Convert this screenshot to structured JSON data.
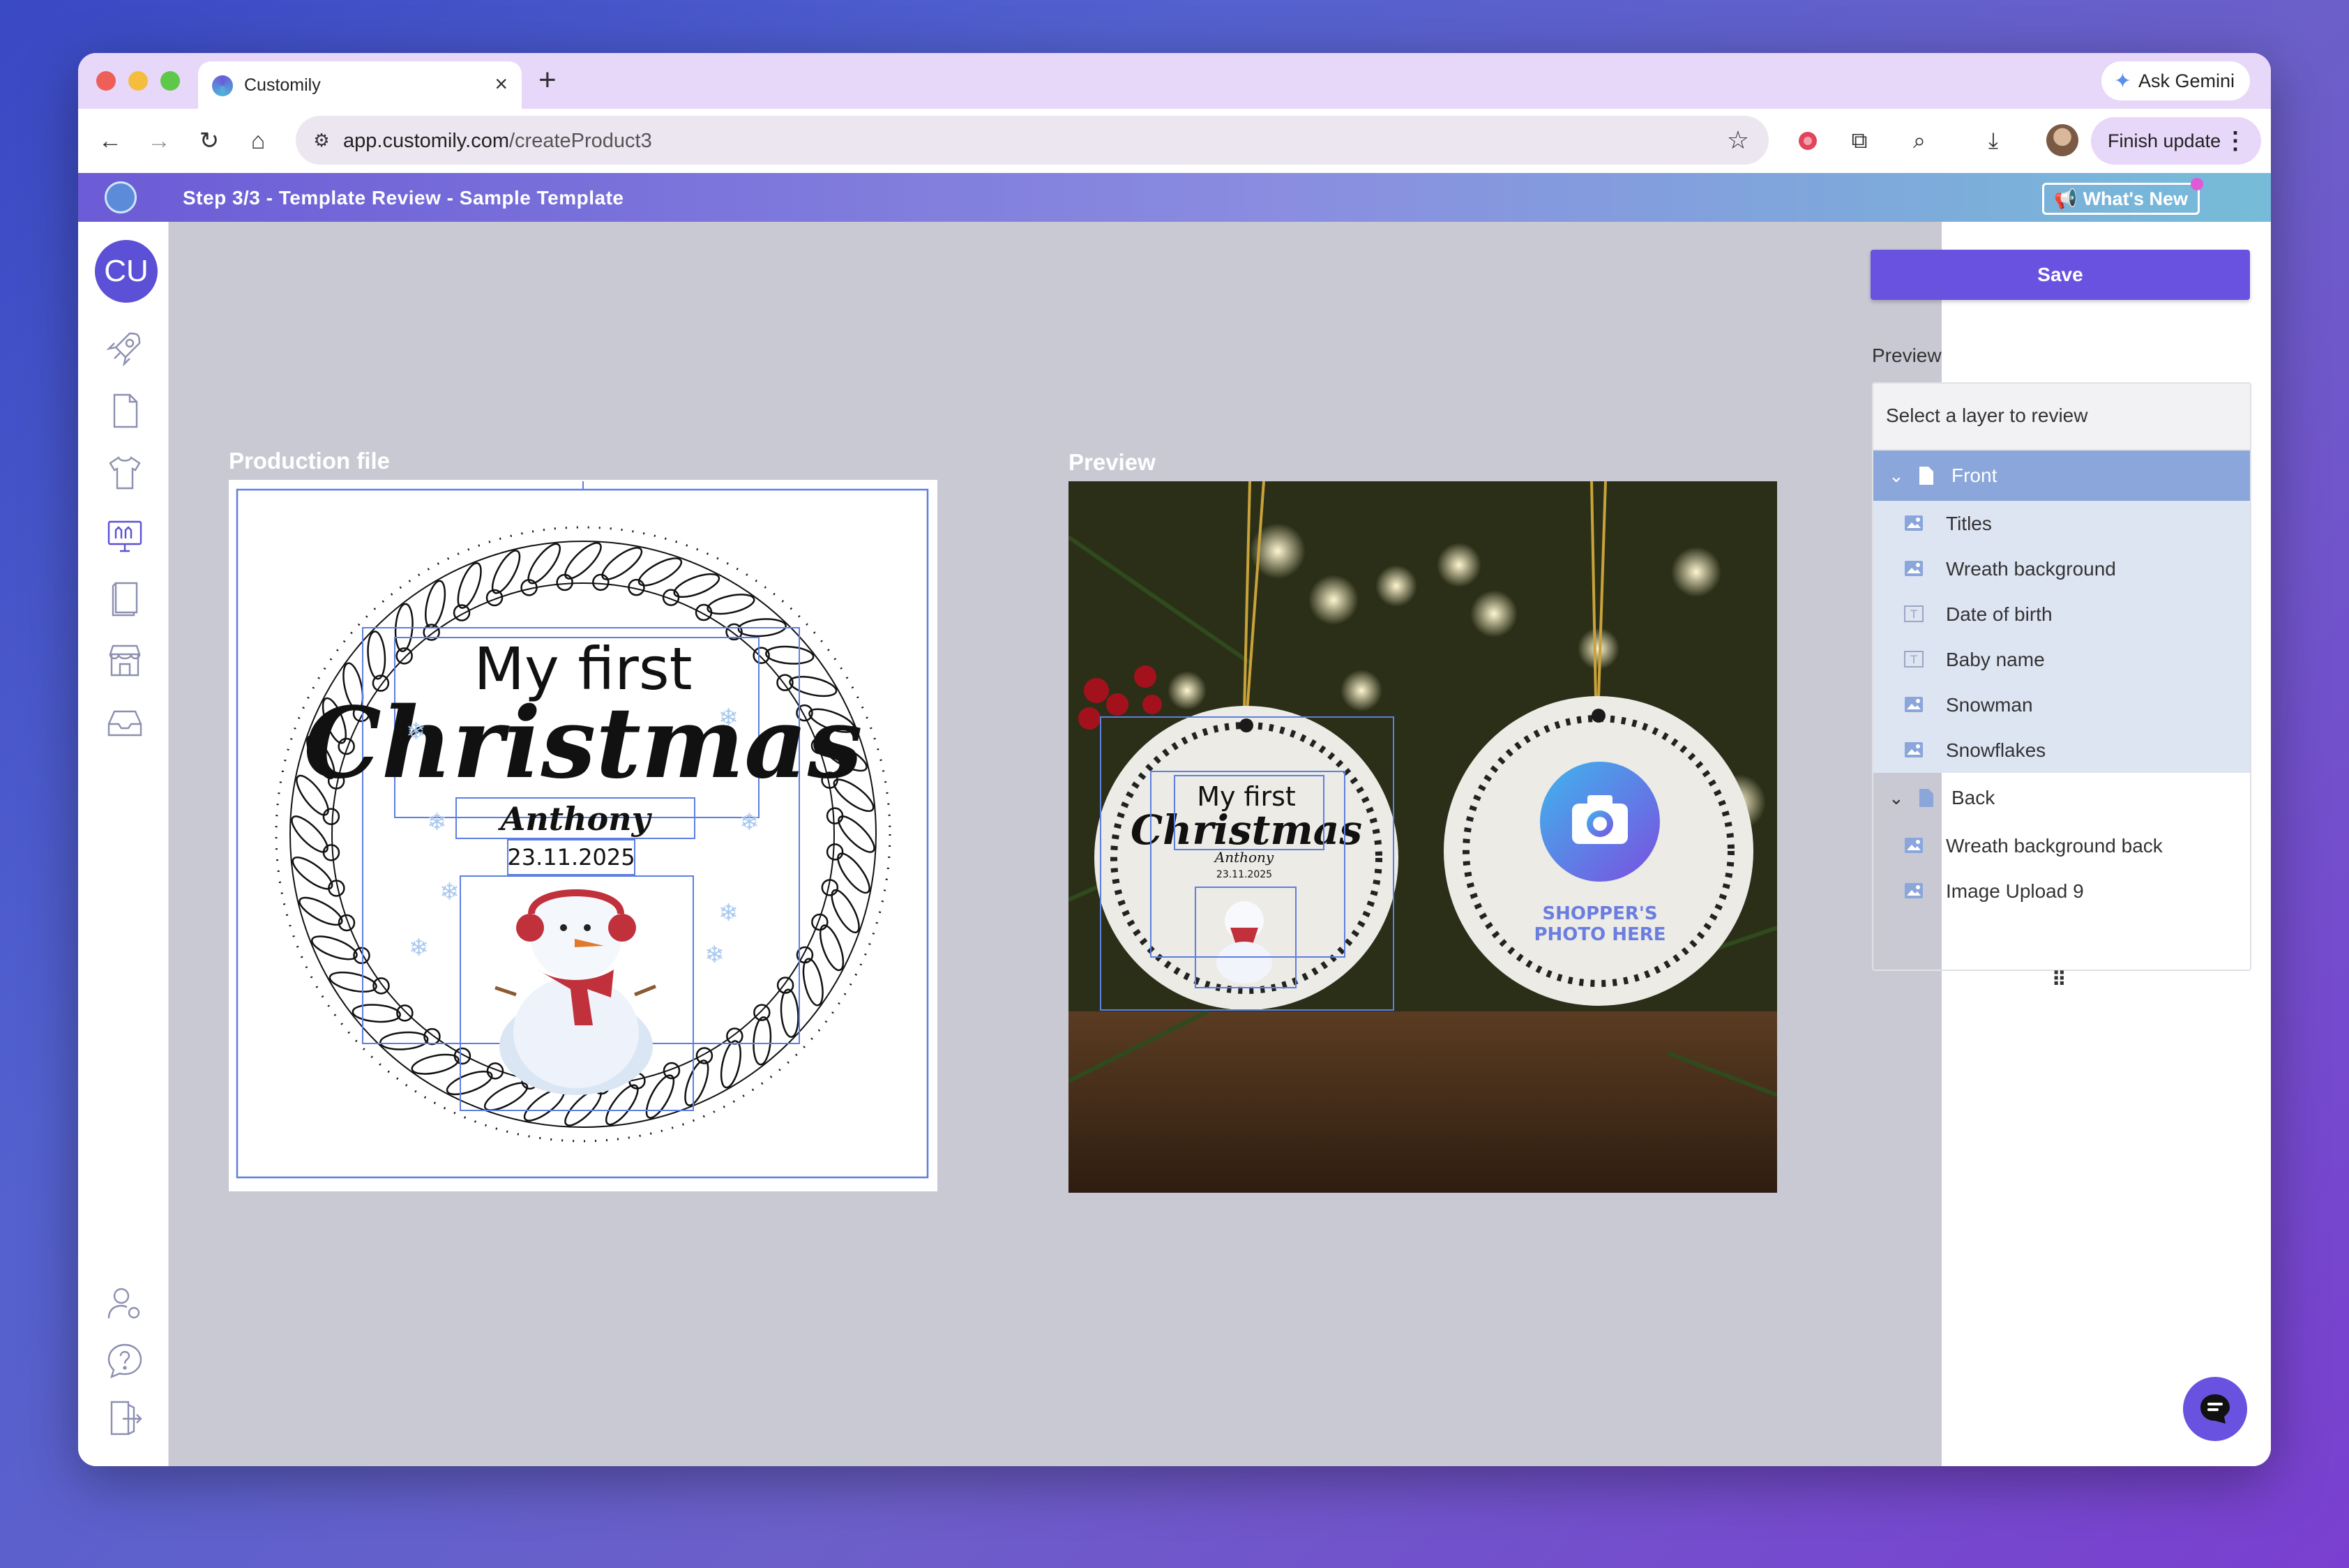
{
  "browser": {
    "tab_title": "Customily",
    "tab_close": "×",
    "new_tab": "+",
    "ask_gemini": "Ask Gemini",
    "url_host": "app.customily.com",
    "url_path": "/createProduct3",
    "finish_update": "Finish update"
  },
  "app": {
    "step_title": "Step 3/3 - Template Review - Sample Template",
    "whats_new": "What's New",
    "user_initials": "CU"
  },
  "canvas": {
    "production_label": "Production file",
    "preview_label": "Preview",
    "design": {
      "title_line1": "My first",
      "title_line2": "Christmas",
      "baby_name": "Anthony",
      "date_of_birth": "23.11.2025"
    },
    "ornament_back_text_line1": "SHOPPER'S",
    "ornament_back_text_line2": "PHOTO HERE"
  },
  "panel": {
    "save_label": "Save",
    "preview_title": "Preview",
    "select_hint": "Select a layer to review",
    "groups": [
      {
        "name": "Front",
        "selected": true,
        "items": [
          {
            "name": "Titles",
            "icon": "image-icon"
          },
          {
            "name": "Wreath background",
            "icon": "image-icon"
          },
          {
            "name": "Date of birth",
            "icon": "text-icon"
          },
          {
            "name": "Baby name",
            "icon": "text-icon"
          },
          {
            "name": "Snowman",
            "icon": "image-icon"
          },
          {
            "name": "Snowflakes",
            "icon": "image-icon"
          }
        ]
      },
      {
        "name": "Back",
        "selected": false,
        "items": [
          {
            "name": "Wreath background back",
            "icon": "image-icon"
          },
          {
            "name": "Image Upload 9",
            "icon": "image-upload-icon"
          }
        ]
      }
    ]
  },
  "colors": {
    "accent": "#6a52e0",
    "selected_layer": "#8aa6da",
    "canvas_bg": "#c9c9d4"
  }
}
